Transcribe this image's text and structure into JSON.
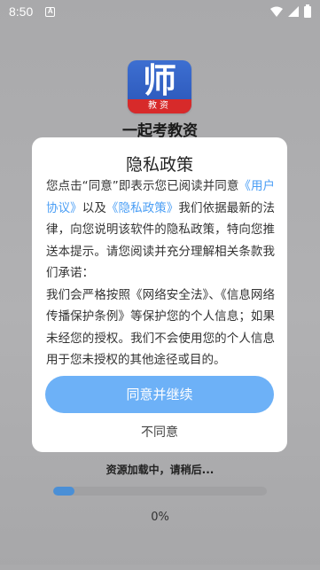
{
  "status_bar": {
    "time": "8:50",
    "notification_icon": "A"
  },
  "app": {
    "logo_glyph": "师",
    "logo_band": "教资",
    "name": "一起考教资"
  },
  "dialog": {
    "title": "隐私政策",
    "body": {
      "p1_before": "您点击“同意”即表示您已阅读并同意",
      "link_user_agreement": "《用户协议》",
      "p1_middle": "以及",
      "link_privacy_policy": "《隐私政策》",
      "p1_after": "我们依据最新的法律，向您说明该软件的隐私政策，特向您推送本提示。请您阅读并充分理解相关条款我们承诺：",
      "p2": "我们会严格按照《网络安全法》、《信息网络传播保护条例》等保护您的个人信息；如果未经您的授权。我们不会使用您的个人信息用于您未授权的其他途径或目的。"
    },
    "agree_label": "同意并继续",
    "disagree_label": "不同意"
  },
  "loading": {
    "text": "资源加载中，请稍后...",
    "progress_fraction": 0.1,
    "percent_label": "0%"
  },
  "colors": {
    "accent": "#6db1f7",
    "link": "#4a9ef5",
    "progress": "#4a8fd6",
    "logo_blue": "#2a55b8",
    "logo_red": "#d72a2a"
  },
  "icons": [
    "wifi-icon",
    "signal-icon",
    "battery-icon"
  ]
}
